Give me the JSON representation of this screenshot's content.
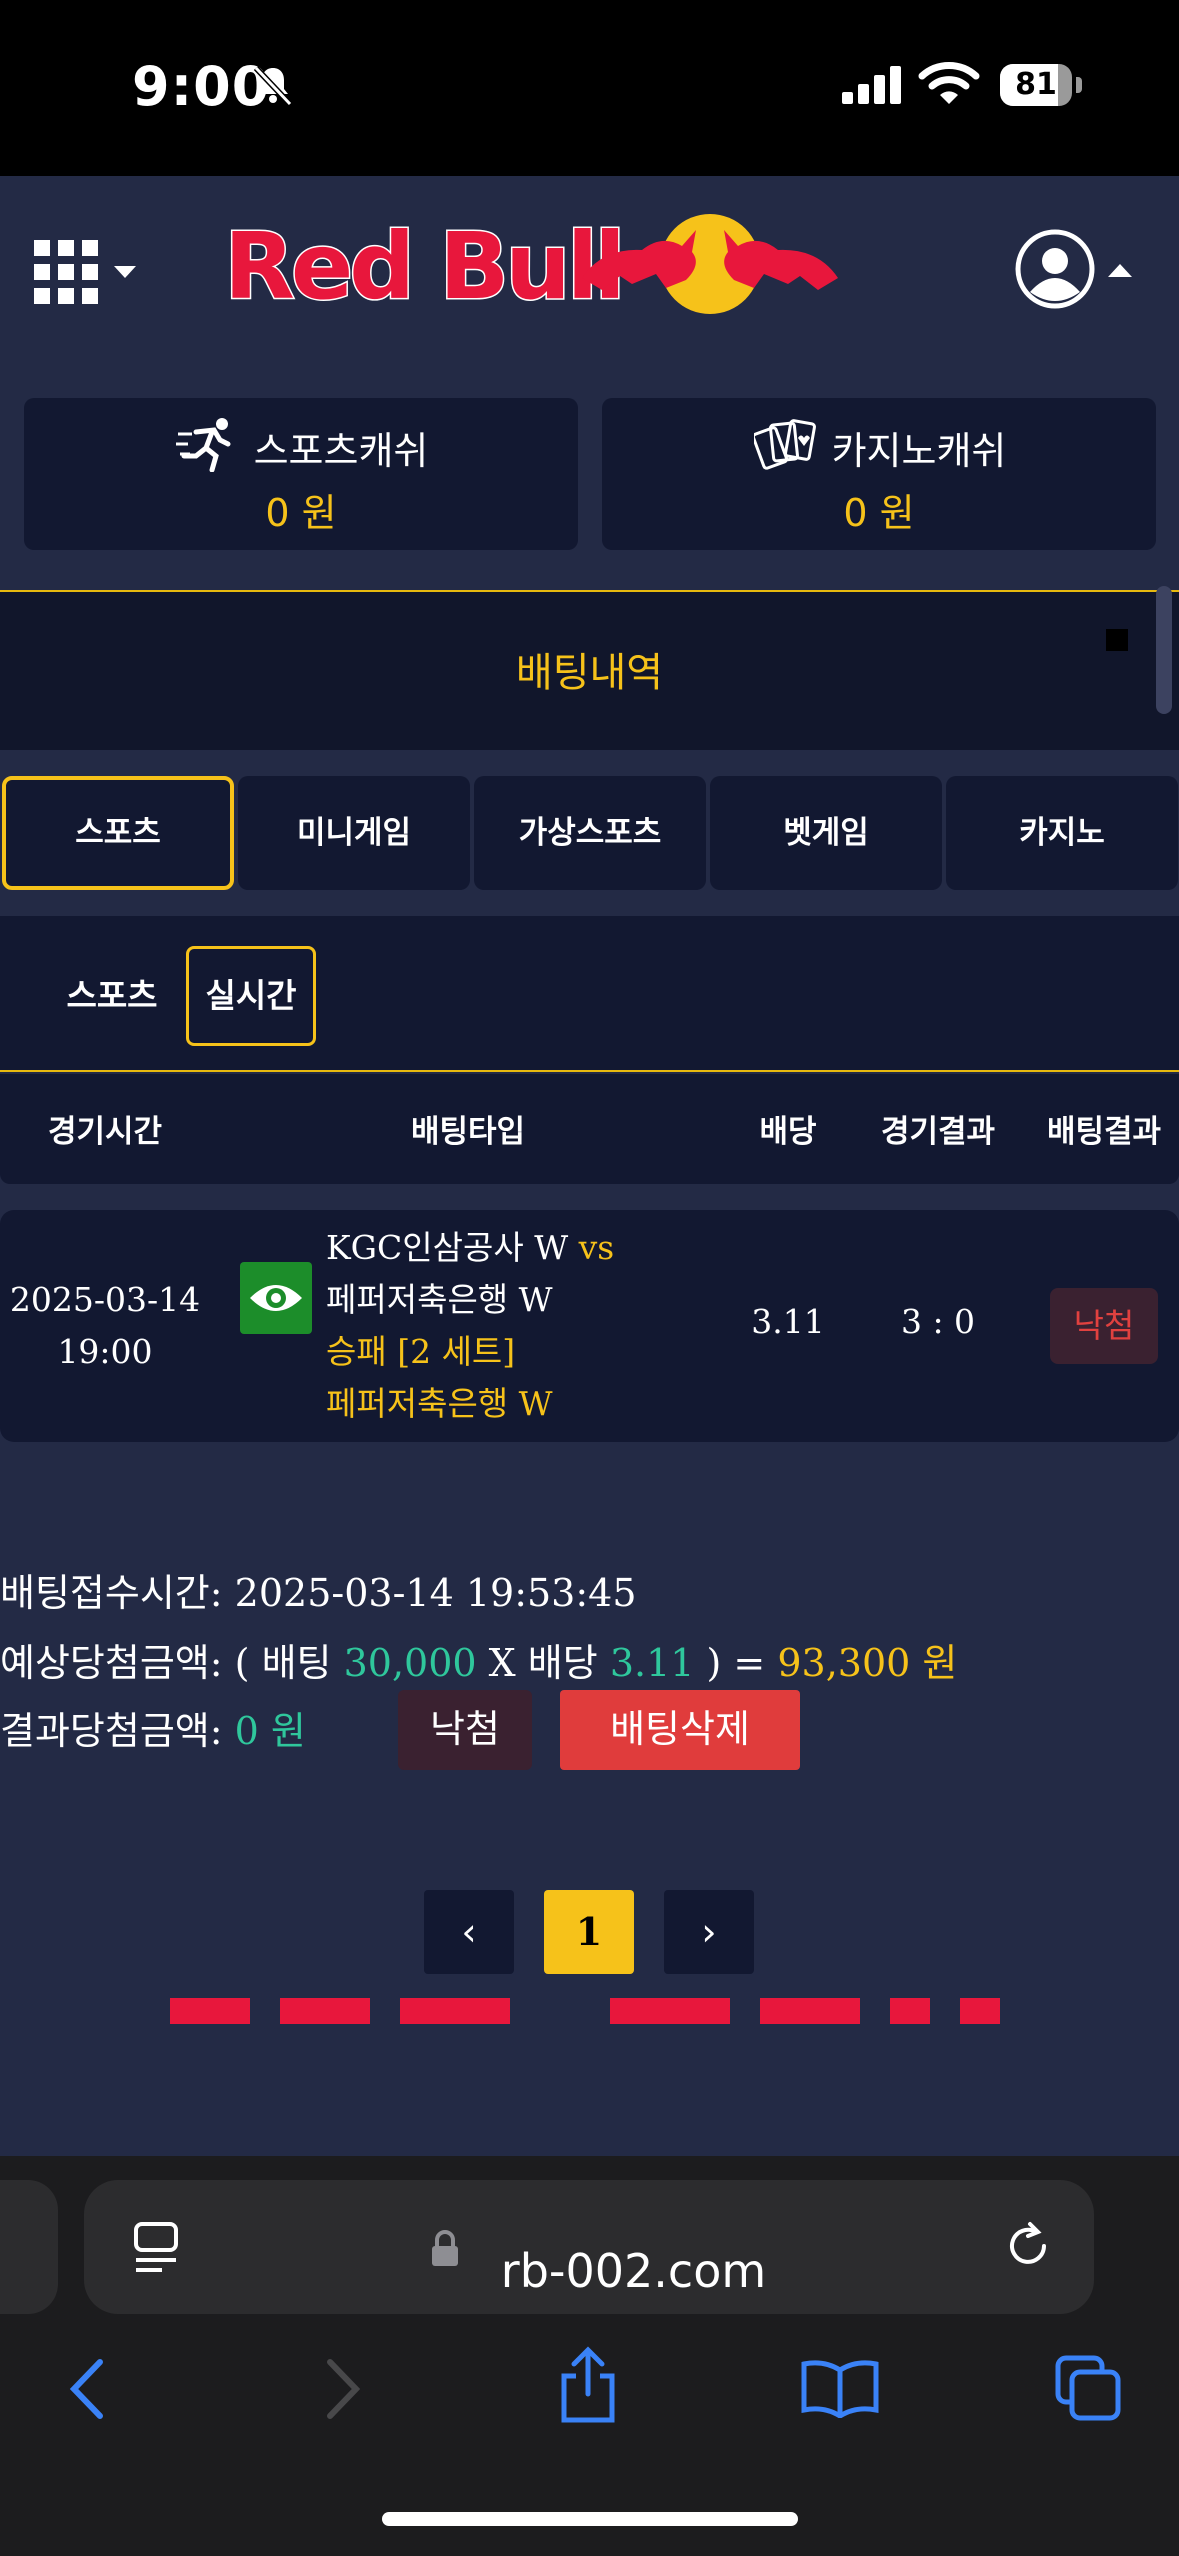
{
  "status_bar": {
    "time": "9:00",
    "battery": "81",
    "battery_level": 0.81
  },
  "header": {
    "logo_text": "Red Bull",
    "sports_cash": {
      "label": "스포츠캐쉬",
      "amount": "0 원"
    },
    "casino_cash": {
      "label": "카지노캐쉬",
      "amount": "0 원"
    }
  },
  "page_title": "배팅내역",
  "tabs": [
    {
      "label": "스포츠",
      "active": true
    },
    {
      "label": "미니게임",
      "active": false
    },
    {
      "label": "가상스포츠",
      "active": false
    },
    {
      "label": "벳게임",
      "active": false
    },
    {
      "label": "카지노",
      "active": false
    }
  ],
  "subtabs": [
    {
      "label": "스포츠",
      "active": false
    },
    {
      "label": "실시간",
      "active": true
    }
  ],
  "columns": [
    "경기시간",
    "배팅타입",
    "배당",
    "경기결과",
    "배팅결과"
  ],
  "bet": {
    "date": "2025-03-14",
    "time": "19:00",
    "home": "KGC인삼공사 W",
    "vs": "vs",
    "away": "페퍼저축은행 W",
    "market": "승패 [2 세트]",
    "pick": "페퍼저축은행 W",
    "odds": "3.11",
    "score": "3 : 0",
    "result": "낙첨"
  },
  "summary": {
    "accept_label": "배팅접수시간:",
    "accept_time": "2025-03-14 19:53:45",
    "expected_label": "예상당첨금액:",
    "expected_open": "( 배팅",
    "stake": "30,000",
    "times": "X 배당",
    "odds": "3.11",
    "expected_close": ") =",
    "expected_amount": "93,300 원",
    "result_label": "결과당첨금액:",
    "result_amount": "0 원",
    "lost_button": "낙첨",
    "delete_button": "배팅삭제"
  },
  "pagination": {
    "prev": "‹",
    "current": "1",
    "next": "›"
  },
  "browser": {
    "url": "rb-002.com"
  }
}
